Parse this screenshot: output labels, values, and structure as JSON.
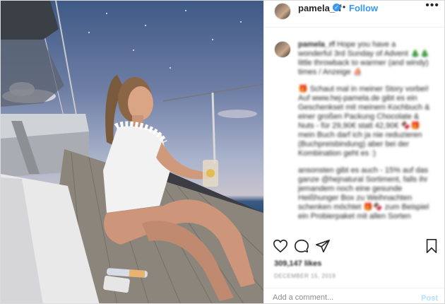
{
  "post": {
    "username": "pamela_rf",
    "verified_mark": "✓",
    "separator": "•",
    "follow_label": "Follow",
    "more_label": "•••",
    "caption_user": "pamela_rf",
    "caption_paragraphs": [
      "Hope you have a wonderful 3rd Sunday of Advent 🎄🎄 little throwback to warmer (and windy) times / Anzeige ⛵",
      "🎁 Schaut mal in meiner Story vorbei! Auf www.hej-pamela.de gibt es ein Geschenkset mit meinem Kochbuch & einer großen Packung Chocolate & Nuts - für 29,90€ statt 42,90€ 🍫🎁 mein Buch darf ich ja nie reduzieren (Buchpreisbindung) aber bei der Kombination geht es :)",
      "ansonsten gibt es auch - 15% auf das ganze @hejnatural Sortiment, falls ihr jemandem noch eine gesunde Heißhunger Box zu Weihnachten schenken möchtet 🎁🍫 zum Beispiel ein Probierpaket mit allen Sorten"
    ],
    "mention": "@hejnatural",
    "likes": "309,147 likes",
    "date": "DECEMBER 15, 2019",
    "comment_placeholder": "Add a comment...",
    "post_label": "Post"
  },
  "icons": [
    "heart-icon",
    "comment-icon",
    "share-icon",
    "bookmark-icon",
    "more-options-icon",
    "verified-badge-icon"
  ],
  "colors": {
    "accent": "#3897f0",
    "text": "#262626",
    "muted": "#8e8e8e",
    "post_disabled": "#b2dffc"
  }
}
